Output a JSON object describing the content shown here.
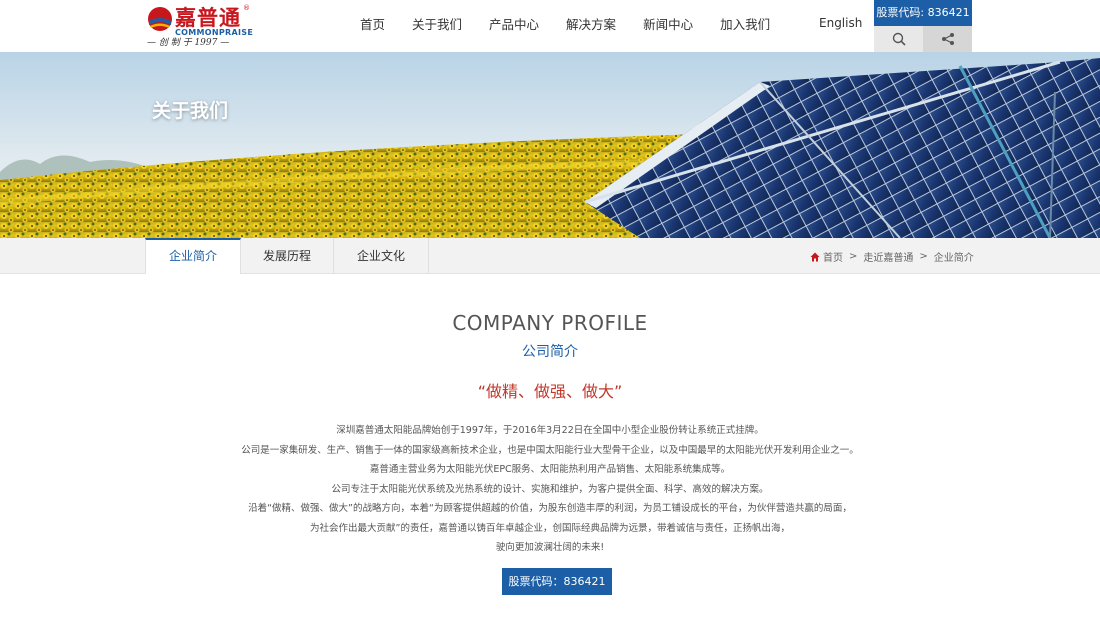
{
  "header": {
    "logo": {
      "name_cn": "嘉普通",
      "name_en": "COMMONPRAISE",
      "reg_mark": "®",
      "slogan": "— 创 制 于 1997 —"
    },
    "nav": [
      "首页",
      "关于我们",
      "产品中心",
      "解决方案",
      "新闻中心",
      "加入我们"
    ],
    "lang": "English",
    "stock_code": "股票代码: 836421",
    "icons": {
      "search": "search-icon",
      "share": "share-icon"
    }
  },
  "banner": {
    "title": "关于我们"
  },
  "subnav": {
    "tabs": [
      "企业简介",
      "发展历程",
      "企业文化"
    ],
    "active_tab": 0,
    "breadcrumb": {
      "home": "首页",
      "sep": ">",
      "level1": "走近嘉普通",
      "level2": "企业简介"
    }
  },
  "content": {
    "title_en": "COMPANY PROFILE",
    "title_cn": "公司简介",
    "slogan": "“做精、做强、做大”",
    "paragraphs": [
      "深圳嘉普通太阳能品牌始创于1997年，于2016年3月22日在全国中小型企业股份转让系统正式挂牌。",
      "公司是一家集研发、生产、销售于一体的国家级高新技术企业，也是中国太阳能行业大型骨干企业，以及中国最早的太阳能光伏开发利用企业之一。",
      "嘉普通主营业务为太阳能光伏EPC服务、太阳能热利用产品销售、太阳能系统集成等。",
      "公司专注于太阳能光伏系统及光热系统的设计、实施和维护，为客户提供全面、科学、高效的解决方案。",
      "沿着“做精、做强、做大”的战略方向，本着“为顾客提供超越的价值，为股东创造丰厚的利润，为员工铺设成长的平台，为伙伴营造共赢的局面，",
      "为社会作出最大贡献”的责任，嘉普通以铸百年卓越企业，创国际经典品牌为远景，带着诚信与责任，正扬帆出海，",
      "驶向更加波澜壮阔的未来!"
    ],
    "stock_button": "股票代码：836421"
  },
  "colors": {
    "brand_blue": "#1d5fa6",
    "brand_red": "#c8161d",
    "slogan_red": "#c0392b"
  }
}
